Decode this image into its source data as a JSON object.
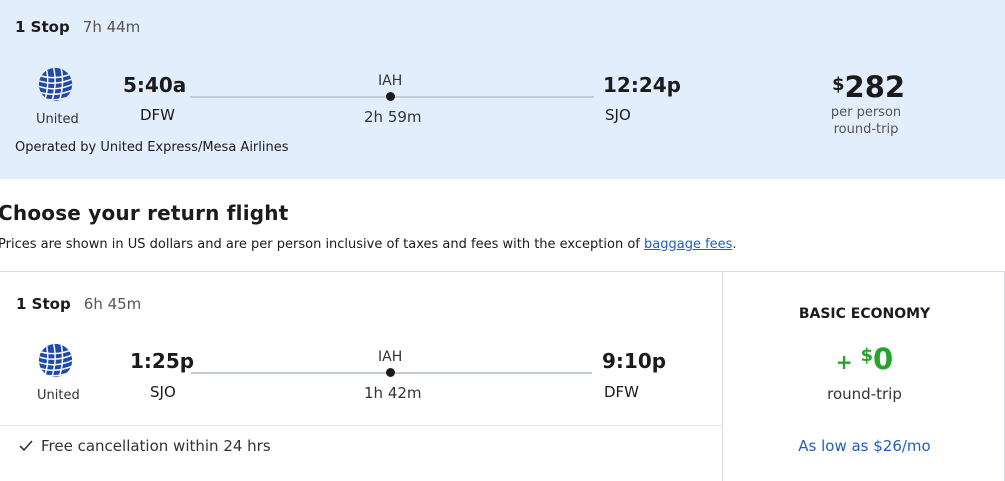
{
  "selected_flight": {
    "stops": "1 Stop",
    "duration": "7h 44m",
    "airline": "United",
    "depart_time": "5:40a",
    "depart_airport": "DFW",
    "arrive_time": "12:24p",
    "arrive_airport": "SJO",
    "connection_airport": "IAH",
    "connection_duration": "2h 59m",
    "operated_by": "Operated by United Express/Mesa Airlines",
    "price_symbol": "$",
    "price": "282",
    "price_sub1": "per person",
    "price_sub2": "round-trip"
  },
  "section": {
    "title": "Choose your return flight",
    "note_prefix": "Prices are shown in US dollars and are per person inclusive of taxes and fees with the exception of ",
    "note_link": "baggage fees",
    "note_suffix": "."
  },
  "return_flight": {
    "stops": "1 Stop",
    "duration": "6h 45m",
    "airline": "United",
    "depart_time": "1:25p",
    "depart_airport": "SJO",
    "arrive_time": "9:10p",
    "arrive_airport": "DFW",
    "connection_airport": "IAH",
    "connection_duration": "1h 42m",
    "cancellation": "Free cancellation within 24 hrs",
    "fare_class": "BASIC ECONOMY",
    "fare_plus": "+",
    "fare_symbol": "$",
    "fare_amount": "0",
    "fare_sub": "round-trip",
    "as_low_as": "As low as $26/mo"
  },
  "colors": {
    "selected_bg": "#e3eefc",
    "fare_green": "#24a428",
    "link_blue": "#1f5fbf"
  },
  "icons": {
    "airline_logo": "united-globe-icon",
    "check": "check-icon"
  }
}
